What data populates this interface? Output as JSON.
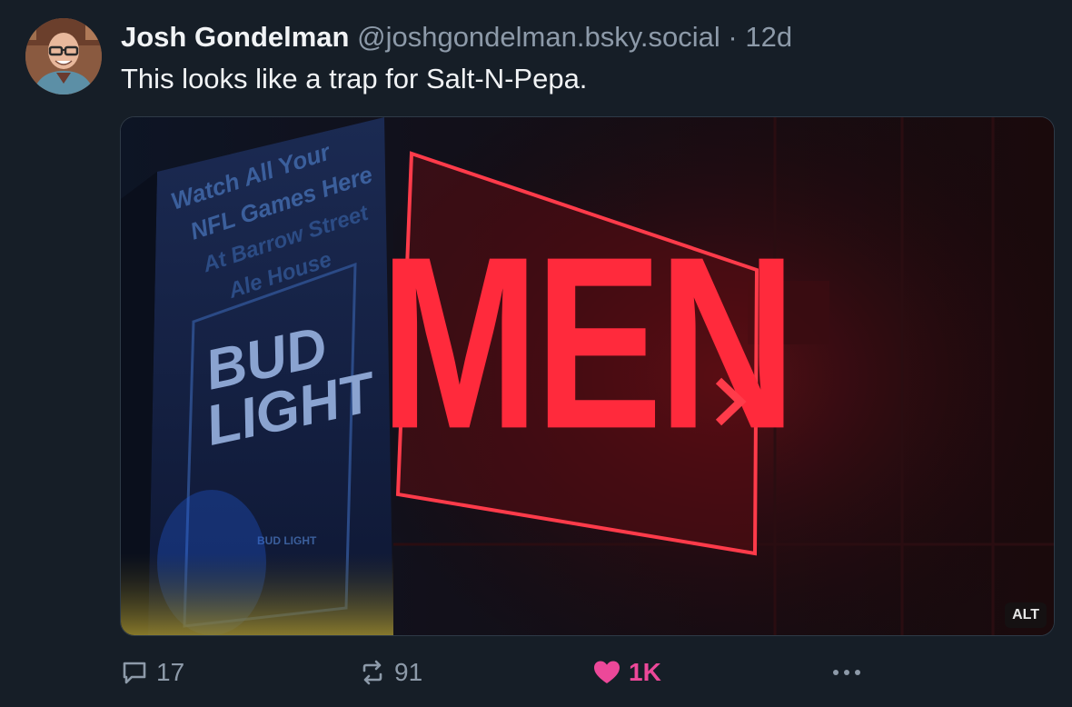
{
  "post": {
    "author_name": "Josh Gondelman",
    "handle": "@joshgondelman.bsky.social",
    "separator": "·",
    "time": "12d",
    "text": "This looks like a trap for Salt-N-Pepa."
  },
  "media": {
    "alt_badge": "ALT",
    "sign_text": "MEN",
    "poster_lines": [
      "Watch All Your",
      "NFL Games Here",
      "At Barrow Street",
      "Ale House"
    ],
    "poster_brand": [
      "BUD",
      "LIGHT"
    ],
    "can_brand": "BUD LIGHT"
  },
  "actions": {
    "reply_count": "17",
    "repost_count": "91",
    "like_count": "1K"
  },
  "colors": {
    "background": "#161e27",
    "muted": "#8d9aa9",
    "like": "#ec4899",
    "sign_red": "#ff2a3c"
  },
  "icons": [
    "reply-icon",
    "repost-icon",
    "heart-icon",
    "more-icon",
    "chevron-right-icon"
  ]
}
